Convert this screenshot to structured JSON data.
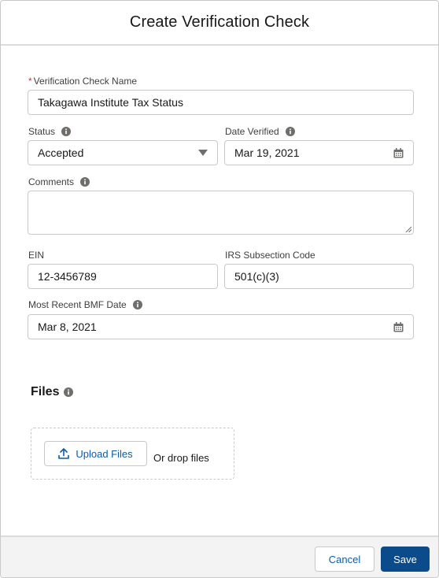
{
  "modal": {
    "title": "Create Verification Check"
  },
  "form": {
    "name": {
      "label": "Verification Check Name",
      "required_mark": "*",
      "value": "Takagawa Institute Tax Status"
    },
    "status": {
      "label": "Status",
      "value": "Accepted"
    },
    "date_verified": {
      "label": "Date Verified",
      "value": "Mar 19, 2021"
    },
    "comments": {
      "label": "Comments",
      "value": ""
    },
    "ein": {
      "label": "EIN",
      "value": "12-3456789"
    },
    "irs_code": {
      "label": "IRS Subsection Code",
      "value": "501(c)(3)"
    },
    "bmf_date": {
      "label": "Most Recent BMF Date",
      "value": "Mar 8, 2021"
    }
  },
  "files": {
    "title": "Files",
    "upload_label": "Upload Files",
    "drop_text": "Or drop files"
  },
  "footer": {
    "cancel_label": "Cancel",
    "save_label": "Save"
  },
  "colors": {
    "brand_button": "#0b4a8b",
    "link_blue": "#0b5cab",
    "required_red": "#c23934",
    "icon_gray": "#706e6b"
  },
  "icons": {
    "info": "info-icon",
    "calendar": "calendar-icon",
    "caret": "chevron-down-icon",
    "upload": "upload-icon"
  }
}
